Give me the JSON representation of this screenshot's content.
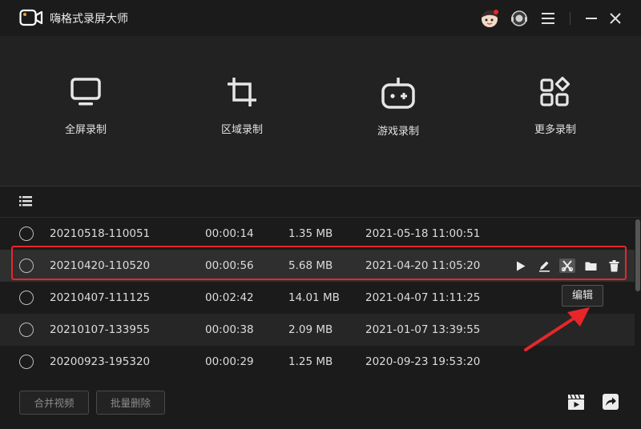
{
  "app": {
    "title": "嗨格式录屏大师"
  },
  "modes": [
    {
      "label": "全屏录制",
      "icon": "monitor-icon"
    },
    {
      "label": "区域录制",
      "icon": "crop-icon"
    },
    {
      "label": "游戏录制",
      "icon": "gamepad-icon"
    },
    {
      "label": "更多录制",
      "icon": "more-grid-icon"
    }
  ],
  "recordings": [
    {
      "name": "20210518-110051",
      "duration": "00:00:14",
      "size": "1.35 MB",
      "date": "2021-05-18 11:00:51"
    },
    {
      "name": "20210420-110520",
      "duration": "00:00:56",
      "size": "5.68 MB",
      "date": "2021-04-20 11:05:20"
    },
    {
      "name": "20210407-111125",
      "duration": "00:02:42",
      "size": "14.01 MB",
      "date": "2021-04-07 11:11:25"
    },
    {
      "name": "20210107-133955",
      "duration": "00:00:38",
      "size": "2.09 MB",
      "date": "2021-01-07 13:39:55"
    },
    {
      "name": "20200923-195320",
      "duration": "00:00:29",
      "size": "1.25 MB",
      "date": "2020-09-23 19:53:20"
    }
  ],
  "tooltip": {
    "text": "编辑"
  },
  "footer": {
    "merge_label": "合并视频",
    "batch_delete_label": "批量删除"
  },
  "colors": {
    "background": "#1b1b1b",
    "panel": "#222222",
    "highlight": "#e8262a"
  }
}
